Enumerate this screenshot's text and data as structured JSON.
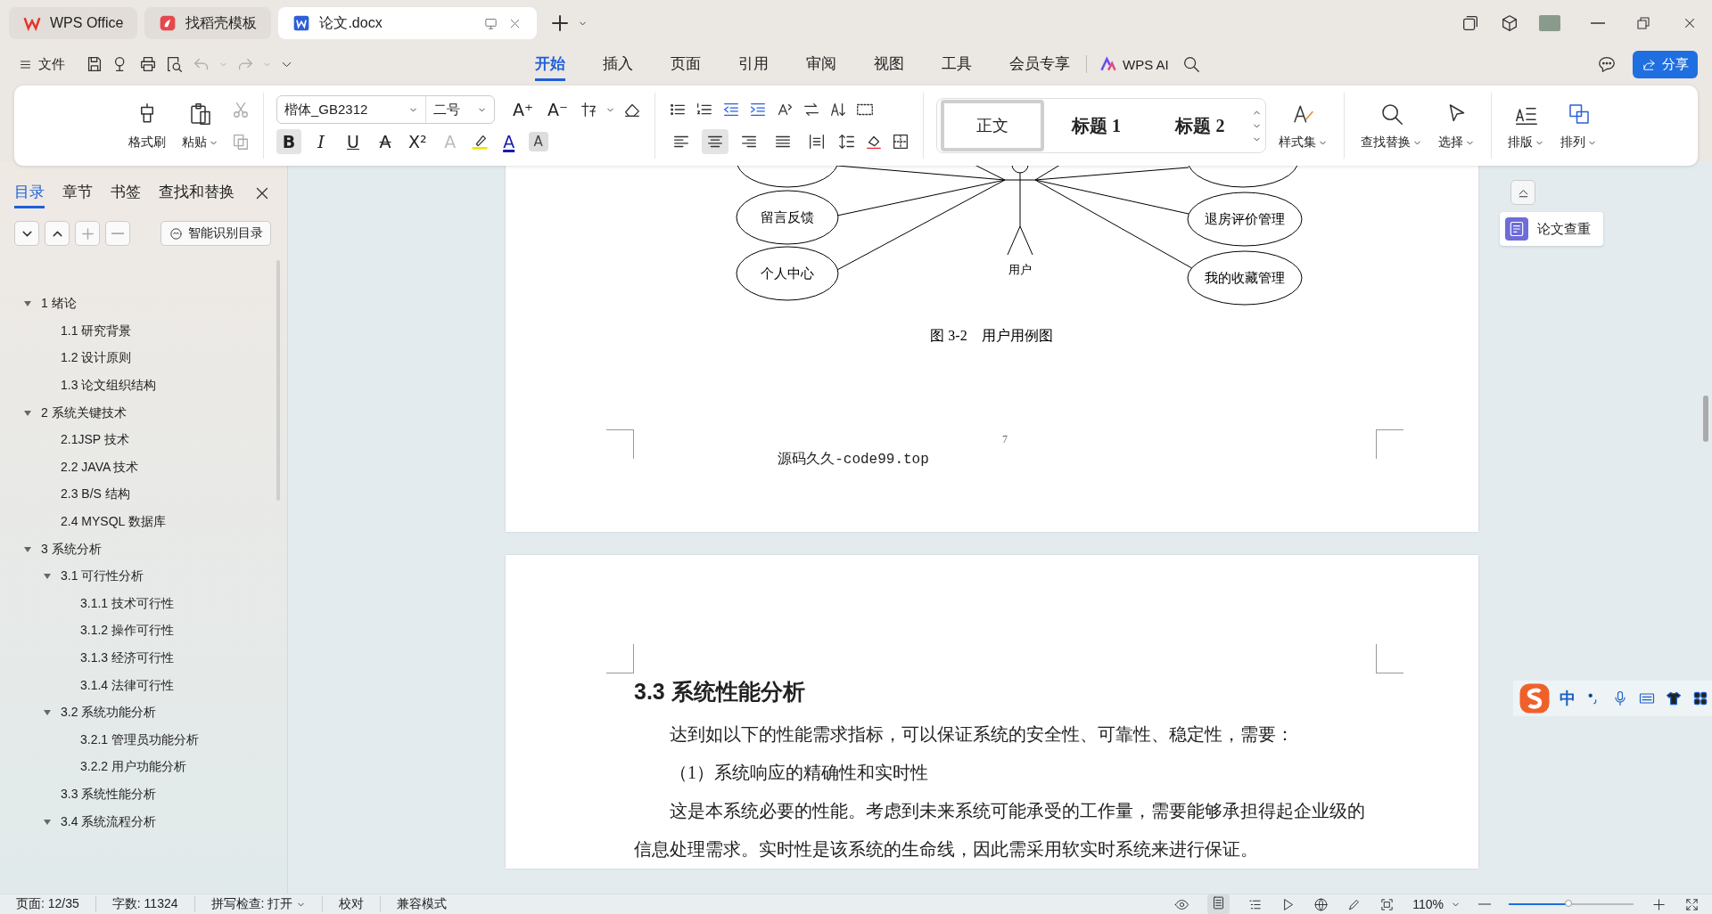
{
  "tabs": [
    {
      "label": "WPS Office",
      "kind": "home",
      "selected": false
    },
    {
      "label": "找稻壳模板",
      "kind": "template",
      "selected": false
    },
    {
      "label": "论文.docx",
      "kind": "doc",
      "selected": true
    }
  ],
  "file_menu": "文件",
  "menu": [
    {
      "label": "开始",
      "selected": true
    },
    {
      "label": "插入",
      "selected": false
    },
    {
      "label": "页面",
      "selected": false
    },
    {
      "label": "引用",
      "selected": false
    },
    {
      "label": "审阅",
      "selected": false
    },
    {
      "label": "视图",
      "selected": false
    },
    {
      "label": "工具",
      "selected": false
    },
    {
      "label": "会员专享",
      "selected": false
    }
  ],
  "ai_button": "WPS AI",
  "share_button": "分享",
  "ribbon": {
    "format_painter": "格式刷",
    "paste": "粘贴",
    "font": "楷体_GB2312",
    "size": "二号",
    "grow_font": "A⁺",
    "shrink_font": "A⁻",
    "font_buttons": [
      {
        "label": "B",
        "kind": "bold",
        "selected": true,
        "disabled": false
      },
      {
        "label": "I",
        "kind": "italic",
        "selected": false,
        "disabled": false
      },
      {
        "label": "U",
        "kind": "underline",
        "selected": false,
        "disabled": false
      },
      {
        "label": "A",
        "kind": "strike",
        "selected": false,
        "disabled": false
      },
      {
        "label": "X²",
        "kind": "super",
        "selected": false,
        "disabled": false
      },
      {
        "label": "A",
        "kind": "effect",
        "selected": false,
        "disabled": true
      },
      {
        "label": "A",
        "kind": "color",
        "selected": false,
        "disabled": false
      },
      {
        "label": "A",
        "kind": "shade",
        "selected": false,
        "disabled": false
      }
    ],
    "align": [
      {
        "kind": "left",
        "selected": false
      },
      {
        "kind": "center",
        "selected": true
      },
      {
        "kind": "right",
        "selected": false
      },
      {
        "kind": "justify",
        "selected": false
      },
      {
        "kind": "distribute",
        "selected": false
      }
    ],
    "styles": [
      {
        "label": "正文",
        "selected": true
      },
      {
        "label": "标题 1",
        "selected": false
      },
      {
        "label": "标题 2",
        "selected": false
      }
    ],
    "style_set": "样式集",
    "find_replace": "查找替换",
    "select": "选择",
    "layout": "排版",
    "arrange": "排列"
  },
  "nav": {
    "tabs": [
      {
        "label": "目录",
        "selected": true
      },
      {
        "label": "章节",
        "selected": false
      },
      {
        "label": "书签",
        "selected": false
      },
      {
        "label": "查找和替换",
        "selected": false
      }
    ],
    "smart_toc": "智能识别目录",
    "toc": [
      {
        "label": "1 绪论",
        "expanded": true,
        "children": [
          {
            "label": "1.1 研究背景"
          },
          {
            "label": "1.2 设计原则"
          },
          {
            "label": "1.3 论文组织结构"
          }
        ]
      },
      {
        "label": "2 系统关键技术",
        "expanded": true,
        "children": [
          {
            "label": "2.1JSP 技术"
          },
          {
            "label": "2.2 JAVA 技术"
          },
          {
            "label": "2.3 B/S 结构"
          },
          {
            "label": "2.4 MYSQL 数据库"
          }
        ]
      },
      {
        "label": "3 系统分析",
        "expanded": true,
        "children": [
          {
            "label": "3.1 可行性分析",
            "expanded": true,
            "children": [
              {
                "label": "3.1.1 技术可行性"
              },
              {
                "label": "3.1.2 操作可行性"
              },
              {
                "label": "3.1.3 经济可行性"
              },
              {
                "label": "3.1.4 法律可行性"
              }
            ]
          },
          {
            "label": "3.2 系统功能分析",
            "expanded": true,
            "children": [
              {
                "label": "3.2.1 管理员功能分析"
              },
              {
                "label": "3.2.2 用户功能分析"
              }
            ]
          },
          {
            "label": "3.3 系统性能分析"
          },
          {
            "label": "3.4 系统流程分析",
            "expanded": true
          }
        ]
      }
    ]
  },
  "page1": {
    "diagram": {
      "actor": "用户",
      "left_cases": [
        "留言反馈",
        "个人中心"
      ],
      "right_cases": [
        "退房评价管理",
        "我的收藏管理"
      ]
    },
    "caption": "图 3-2　用户用例图",
    "page_number": "7",
    "footer": "源码久久-code99.top"
  },
  "page2": {
    "heading": "3.3 系统性能分析",
    "paragraphs": [
      "达到如以下的性能需求指标，可以保证系统的安全性、可靠性、稳定性，需要：",
      "（1）系统响应的精确性和实时性",
      "这是本系统必要的性能。考虑到未来系统可能承受的工作量，需要能够承担得起企业级的信息处理需求。实时性是该系统的生命线，因此需采用软实时系统来进行保证。"
    ]
  },
  "side_button": "论文查重",
  "ime": {
    "mode": "中"
  },
  "status": {
    "page": "页面: 12/35",
    "words": "字数: 11324",
    "spell": "拼写检查: 打开",
    "proof": "校对",
    "compat": "兼容模式",
    "zoom": "110%",
    "level": 0.48
  }
}
